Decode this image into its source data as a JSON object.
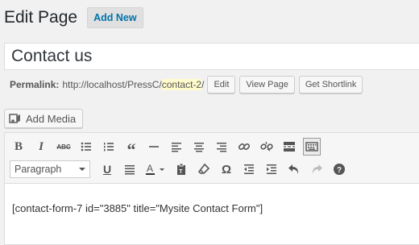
{
  "header": {
    "title": "Edit Page",
    "add_new_label": "Add New"
  },
  "post": {
    "title": "Contact us"
  },
  "permalink": {
    "label": "Permalink:",
    "base_url": "http://localhost/PressC/",
    "slug": "contact-2",
    "trailing": "/",
    "buttons": {
      "edit": "Edit",
      "view": "View Page",
      "shortlink": "Get Shortlink"
    }
  },
  "media": {
    "add_media_label": "Add Media",
    "icon": "media-icon"
  },
  "toolbar": {
    "format_select": {
      "value": "Paragraph"
    },
    "row1_icons": [
      "bold-icon",
      "italic-icon",
      "strikethrough-icon",
      "bulleted-list-icon",
      "numbered-list-icon",
      "blockquote-icon",
      "horizontal-line-icon",
      "align-left-icon",
      "align-center-icon",
      "align-right-icon",
      "insert-link-icon",
      "unlink-icon",
      "read-more-icon",
      "toolbar-toggle-icon"
    ],
    "row2_icons": [
      "underline-icon",
      "justify-icon",
      "text-color-icon",
      "paste-as-text-icon",
      "clear-formatting-icon",
      "special-character-icon",
      "outdent-icon",
      "indent-icon",
      "undo-icon",
      "redo-icon",
      "help-icon"
    ]
  },
  "editor": {
    "content": "[contact-form-7 id=\"3885\" title=\"Mysite Contact Form\"]"
  },
  "colors": {
    "link": "#0073aa",
    "slug_highlight": "#fffbcc",
    "background": "#f1f1f1"
  }
}
